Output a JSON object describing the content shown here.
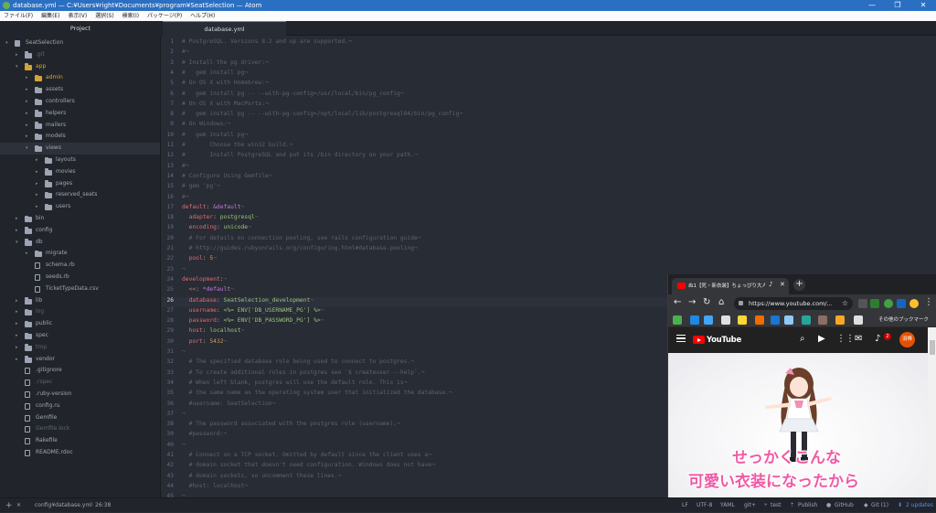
{
  "window": {
    "title": "database.yml — C:¥Users¥right¥Documents¥program¥SeatSelection — Atom",
    "controls": [
      "—",
      "❐",
      "✕"
    ]
  },
  "menu": [
    "ファイル(F)",
    "編集(E)",
    "表示(V)",
    "選択(S)",
    "検索(I)",
    "パッケージ(P)",
    "ヘルプ(H)"
  ],
  "tabs": {
    "project": "Project",
    "file": "database.yml"
  },
  "tree": [
    {
      "label": "SeatSelection",
      "type": "repo",
      "depth": 0,
      "arrow": "▾"
    },
    {
      "label": ".git",
      "type": "folder",
      "depth": 1,
      "arrow": "▸",
      "dim": true
    },
    {
      "label": "app",
      "type": "folder",
      "depth": 1,
      "arrow": "▾",
      "yellow": true
    },
    {
      "label": "admin",
      "type": "folder",
      "depth": 2,
      "arrow": "▸",
      "yellow": true
    },
    {
      "label": "assets",
      "type": "folder",
      "depth": 2,
      "arrow": "▸"
    },
    {
      "label": "controllers",
      "type": "folder",
      "depth": 2,
      "arrow": "▸"
    },
    {
      "label": "helpers",
      "type": "folder",
      "depth": 2,
      "arrow": "▸"
    },
    {
      "label": "mailers",
      "type": "folder",
      "depth": 2,
      "arrow": "▸"
    },
    {
      "label": "models",
      "type": "folder",
      "depth": 2,
      "arrow": "▸"
    },
    {
      "label": "views",
      "type": "folder",
      "depth": 2,
      "arrow": "▾",
      "selected": true
    },
    {
      "label": "layouts",
      "type": "folder",
      "depth": 3,
      "arrow": "▸"
    },
    {
      "label": "movies",
      "type": "folder",
      "depth": 3,
      "arrow": "▸"
    },
    {
      "label": "pages",
      "type": "folder",
      "depth": 3,
      "arrow": "▸"
    },
    {
      "label": "reserved_seats",
      "type": "folder",
      "depth": 3,
      "arrow": "▸"
    },
    {
      "label": "users",
      "type": "folder",
      "depth": 3,
      "arrow": "▸"
    },
    {
      "label": "bin",
      "type": "folder",
      "depth": 1,
      "arrow": "▸"
    },
    {
      "label": "config",
      "type": "folder",
      "depth": 1,
      "arrow": "▸"
    },
    {
      "label": "db",
      "type": "folder",
      "depth": 1,
      "arrow": "▾"
    },
    {
      "label": "migrate",
      "type": "folder",
      "depth": 2,
      "arrow": "▸"
    },
    {
      "label": "schema.rb",
      "type": "file",
      "depth": 2
    },
    {
      "label": "seeds.rb",
      "type": "file",
      "depth": 2
    },
    {
      "label": "TicketTypeData.csv",
      "type": "file",
      "depth": 2
    },
    {
      "label": "lib",
      "type": "folder",
      "depth": 1,
      "arrow": "▸"
    },
    {
      "label": "log",
      "type": "folder",
      "depth": 1,
      "arrow": "▸",
      "dim": true
    },
    {
      "label": "public",
      "type": "folder",
      "depth": 1,
      "arrow": "▸"
    },
    {
      "label": "spec",
      "type": "folder",
      "depth": 1,
      "arrow": "▸"
    },
    {
      "label": "tmp",
      "type": "folder",
      "depth": 1,
      "arrow": "▸",
      "dim": true
    },
    {
      "label": "vendor",
      "type": "folder",
      "depth": 1,
      "arrow": "▸"
    },
    {
      "label": ".gitignore",
      "type": "file",
      "depth": 1
    },
    {
      "label": ".rspec",
      "type": "file",
      "depth": 1,
      "dim": true
    },
    {
      "label": ".ruby-version",
      "type": "file",
      "depth": 1
    },
    {
      "label": "config.ru",
      "type": "file",
      "depth": 1
    },
    {
      "label": "Gemfile",
      "type": "file",
      "depth": 1
    },
    {
      "label": "Gemfile.lock",
      "type": "file",
      "depth": 1,
      "dim": true
    },
    {
      "label": "Rakefile",
      "type": "file",
      "depth": 1
    },
    {
      "label": "README.rdoc",
      "type": "file",
      "depth": 1
    }
  ],
  "editor": {
    "current_line": 26,
    "lines": [
      [
        [
          "c",
          "# PostgreSQL. Versions 8.2 and up are supported.¬"
        ]
      ],
      [
        [
          "c",
          "#¬"
        ]
      ],
      [
        [
          "c",
          "# Install the pg driver:¬"
        ]
      ],
      [
        [
          "c",
          "#   gem install pg¬"
        ]
      ],
      [
        [
          "c",
          "# On OS X with Homebrew:¬"
        ]
      ],
      [
        [
          "c",
          "#   gem install pg -- --with-pg-config=/usr/local/bin/pg_config¬"
        ]
      ],
      [
        [
          "c",
          "# On OS X with MacPorts:¬"
        ]
      ],
      [
        [
          "c",
          "#   gem install pg -- --with-pg-config=/opt/local/lib/postgresql84/bin/pg_config¬"
        ]
      ],
      [
        [
          "c",
          "# On Windows:¬"
        ]
      ],
      [
        [
          "c",
          "#   gem install pg¬"
        ]
      ],
      [
        [
          "c",
          "#       Choose the win32 build.¬"
        ]
      ],
      [
        [
          "c",
          "#       Install PostgreSQL and put its /bin directory on your path.¬"
        ]
      ],
      [
        [
          "c",
          "#¬"
        ]
      ],
      [
        [
          "c",
          "# Configure Using Gemfile¬"
        ]
      ],
      [
        [
          "c",
          "# gem 'pg'¬"
        ]
      ],
      [
        [
          "c",
          "#¬"
        ]
      ],
      [
        [
          "k",
          "default"
        ],
        [
          "t",
          ": "
        ],
        [
          "p",
          "&default"
        ],
        [
          "c",
          "¬"
        ]
      ],
      [
        [
          "c",
          "  "
        ],
        [
          "k",
          "adapter"
        ],
        [
          "t",
          ": "
        ],
        [
          "s",
          "postgresql"
        ],
        [
          "c",
          "¬"
        ]
      ],
      [
        [
          "c",
          "  "
        ],
        [
          "k",
          "encoding"
        ],
        [
          "t",
          ": "
        ],
        [
          "s",
          "unicode"
        ],
        [
          "c",
          "¬"
        ]
      ],
      [
        [
          "c",
          "  # For details on connection pooling, see rails configuration guide¬"
        ]
      ],
      [
        [
          "c",
          "  # http://guides.rubyonrails.org/configuring.html#database-pooling¬"
        ]
      ],
      [
        [
          "c",
          "  "
        ],
        [
          "k",
          "pool"
        ],
        [
          "t",
          ": "
        ],
        [
          "n",
          "5"
        ],
        [
          "c",
          "¬"
        ]
      ],
      [
        [
          "c",
          "¬"
        ]
      ],
      [
        [
          "k",
          "development"
        ],
        [
          "t",
          ":"
        ],
        [
          "c",
          "¬"
        ]
      ],
      [
        [
          "c",
          "  "
        ],
        [
          "k",
          "<<"
        ],
        [
          "t",
          ": "
        ],
        [
          "p",
          "*default"
        ],
        [
          "c",
          "¬"
        ]
      ],
      [
        [
          "c",
          "  "
        ],
        [
          "k",
          "database"
        ],
        [
          "t",
          ": "
        ],
        [
          "s",
          "SeatSelection_development"
        ],
        [
          "c",
          "¬"
        ]
      ],
      [
        [
          "c",
          "  "
        ],
        [
          "k",
          "username"
        ],
        [
          "t",
          ": "
        ],
        [
          "s",
          "<%= ENV['DB_USERNAME_PG'] %>"
        ],
        [
          "c",
          "¬"
        ]
      ],
      [
        [
          "c",
          "  "
        ],
        [
          "k",
          "password"
        ],
        [
          "t",
          ": "
        ],
        [
          "s",
          "<%= ENV['DB_PASSWORD_PG'] %>"
        ],
        [
          "c",
          "¬"
        ]
      ],
      [
        [
          "c",
          "  "
        ],
        [
          "k",
          "host"
        ],
        [
          "t",
          ": "
        ],
        [
          "s",
          "localhost"
        ],
        [
          "c",
          "¬"
        ]
      ],
      [
        [
          "c",
          "  "
        ],
        [
          "k",
          "port"
        ],
        [
          "t",
          ": "
        ],
        [
          "n",
          "5432"
        ],
        [
          "c",
          "¬"
        ]
      ],
      [
        [
          "c",
          "¬"
        ]
      ],
      [
        [
          "c",
          "  # The specified database role being used to connect to postgres.¬"
        ]
      ],
      [
        [
          "c",
          "  # To create additional roles in postgres see `$ createuser --help`.¬"
        ]
      ],
      [
        [
          "c",
          "  # When left blank, postgres will use the default role. This is¬"
        ]
      ],
      [
        [
          "c",
          "  # the same name as the operating system user that initialized the database.¬"
        ]
      ],
      [
        [
          "c",
          "  #username: SeatSelection¬"
        ]
      ],
      [
        [
          "c",
          "¬"
        ]
      ],
      [
        [
          "c",
          "  # The password associated with the postgres role (username).¬"
        ]
      ],
      [
        [
          "c",
          "  #password:¬"
        ]
      ],
      [
        [
          "c",
          "¬"
        ]
      ],
      [
        [
          "c",
          "  # Connect on a TCP socket. Omitted by default since the client uses a¬"
        ]
      ],
      [
        [
          "c",
          "  # domain socket that doesn't need configuration. Windows does not have¬"
        ]
      ],
      [
        [
          "c",
          "  # domain sockets, so uncomment these lines.¬"
        ]
      ],
      [
        [
          "c",
          "  #host: localhost¬"
        ]
      ],
      [
        [
          "c",
          "¬"
        ]
      ]
    ]
  },
  "status": {
    "add": "+",
    "close": "✕",
    "file_path": "config¥database.yml",
    "cursor": "26:38",
    "line_ending": "LF",
    "encoding": "UTF-8",
    "grammar": "YAML",
    "git_branch": "git+",
    "test": "test",
    "publish": "Publish",
    "github": "GitHub",
    "git": "Git (1)",
    "updates": "2 updates"
  },
  "browser": {
    "tab_title": "ぬ1【死・新衣装】ちょっぴり大人",
    "url": "https://www.youtube.com/...",
    "bookmark_folder": "その他のブックマーク",
    "site_name": "YouTube",
    "notification_count": "2",
    "avatar_label": "羽棒",
    "caption_line1": "せっかくこんな",
    "caption_line2": "可愛い衣装になったから"
  },
  "colors": {
    "titlebar": "#2b6fc2",
    "folder_yellow": "#d1a43a",
    "youtube_red": "#ff0000",
    "caption_pink": "#f05aa5",
    "avatar_orange": "#e65100"
  }
}
